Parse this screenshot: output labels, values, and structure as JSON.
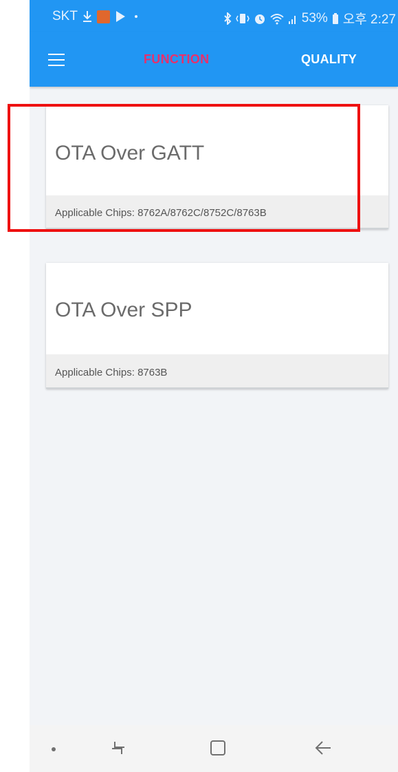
{
  "status_bar": {
    "carrier": "SKT",
    "battery_percent": "53%",
    "time": "오후 2:27",
    "icons": [
      "download-icon",
      "app-notification-icon",
      "play-store-icon",
      "dot-icon",
      "bluetooth-icon",
      "vibrate-icon",
      "alarm-icon",
      "wifi-icon",
      "signal-icon",
      "battery-icon"
    ]
  },
  "app_bar": {
    "menu_icon": "hamburger-menu-icon",
    "tabs": [
      {
        "label": "FUNCTION",
        "selected": true
      },
      {
        "label": "QUALITY",
        "selected": false
      }
    ]
  },
  "cards": [
    {
      "title": "OTA Over GATT",
      "footer": "Applicable Chips: 8762A/8762C/8752C/8763B"
    },
    {
      "title": "OTA Over SPP",
      "footer": "Applicable Chips: 8763B"
    }
  ],
  "nav_bar": {
    "icons": [
      "dot-icon",
      "recent-apps-icon",
      "home-icon",
      "back-icon"
    ]
  },
  "colors": {
    "primary": "#2196f3",
    "accent_selected_tab": "#e8306c",
    "highlight": "#ee1010",
    "background": "#f2f4f7"
  }
}
